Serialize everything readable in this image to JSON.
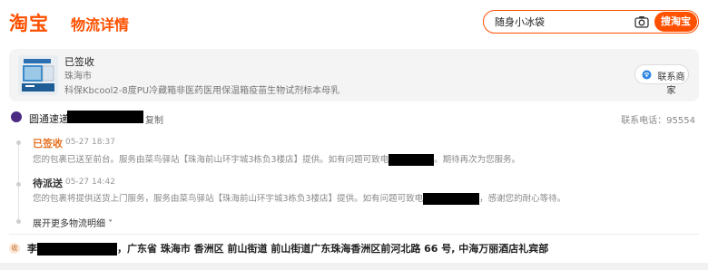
{
  "header": {
    "logo": "淘宝",
    "title": "物流详情",
    "search_value": "随身小冰袋",
    "search_button": "搜淘宝"
  },
  "order": {
    "status": "已签收",
    "city": "珠海市",
    "product": "科保Kbcool2-8度PU冷藏箱非医药医用保温箱疫苗生物试剂标本母乳",
    "contact_label": "联系商家"
  },
  "carrier": {
    "name": "圆通速递",
    "copy_label": "复制",
    "phone": "联系电话：95554"
  },
  "timeline": [
    {
      "status": "已签收",
      "time": "05-27 18:37",
      "detail_before": "您的包裹已送至前台。服务由菜鸟驿站【珠海前山环宇城3栋负3楼店】提供。如有问题可致电",
      "detail_after": "。期待再次为您服务。"
    },
    {
      "status": "待派送",
      "time": "05-27 14:42",
      "detail_before": "您的包裹将提供送货上门服务，服务由菜鸟驿站【珠海前山环宇城3栋负3楼店】提供。如有问题可致电",
      "detail_after": "，感谢您的耐心等待。"
    }
  ],
  "expand_label": "展开更多物流明细 ˅",
  "receiver": {
    "badge": "收",
    "name_prefix": "李",
    "address": "，广东省 珠海市 香洲区 前山街道 前山街道广东珠海香洲区前河北路 66 号, 中海万丽酒店礼宾部"
  },
  "colors": {
    "brand": "#ff5000",
    "signed": "#e4701e",
    "pending": "#333333"
  }
}
